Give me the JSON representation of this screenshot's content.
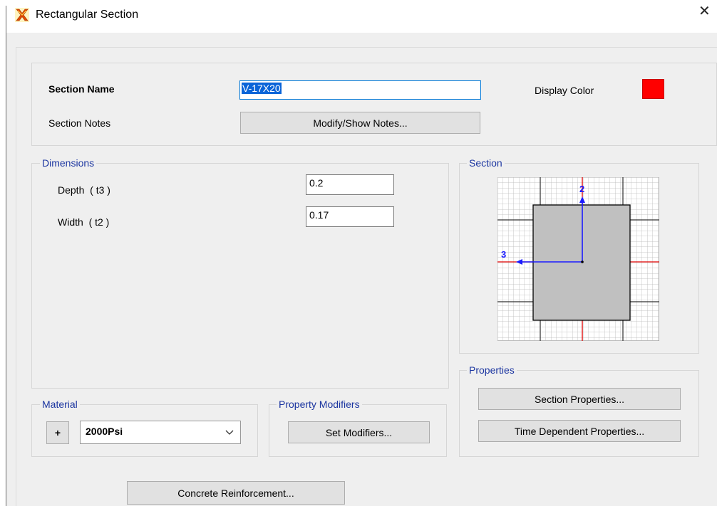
{
  "window": {
    "title": "Rectangular Section",
    "close_glyph": "✕",
    "icon": "sap2000-x-icon"
  },
  "header": {
    "section_name_label": "Section Name",
    "section_name_value": "V-17X20",
    "section_notes_label": "Section Notes",
    "notes_button": "Modify/Show Notes...",
    "display_color_label": "Display Color",
    "display_color": "#ff0000"
  },
  "dimensions": {
    "legend": "Dimensions",
    "depth_label": "Depth  ( t3 )",
    "depth_value": "0.2",
    "width_label": "Width  ( t2 )",
    "width_value": "0.17"
  },
  "section_preview": {
    "legend": "Section",
    "axis2_label": "2",
    "axis3_label": "3"
  },
  "properties": {
    "legend": "Properties",
    "section_properties_button": "Section Properties...",
    "time_dependent_button": "Time Dependent Properties..."
  },
  "material": {
    "legend": "Material",
    "add_button": "+",
    "selected": "2000Psi"
  },
  "property_modifiers": {
    "legend": "Property Modifiers",
    "set_modifiers_button": "Set Modifiers..."
  },
  "footer": {
    "concrete_reinforcement_button": "Concrete Reinforcement..."
  },
  "colors": {
    "legend_text": "#1b35a0",
    "axis_blue": "#1a1aff",
    "axis_red": "#e00000",
    "section_fill": "#c0c0c0"
  }
}
